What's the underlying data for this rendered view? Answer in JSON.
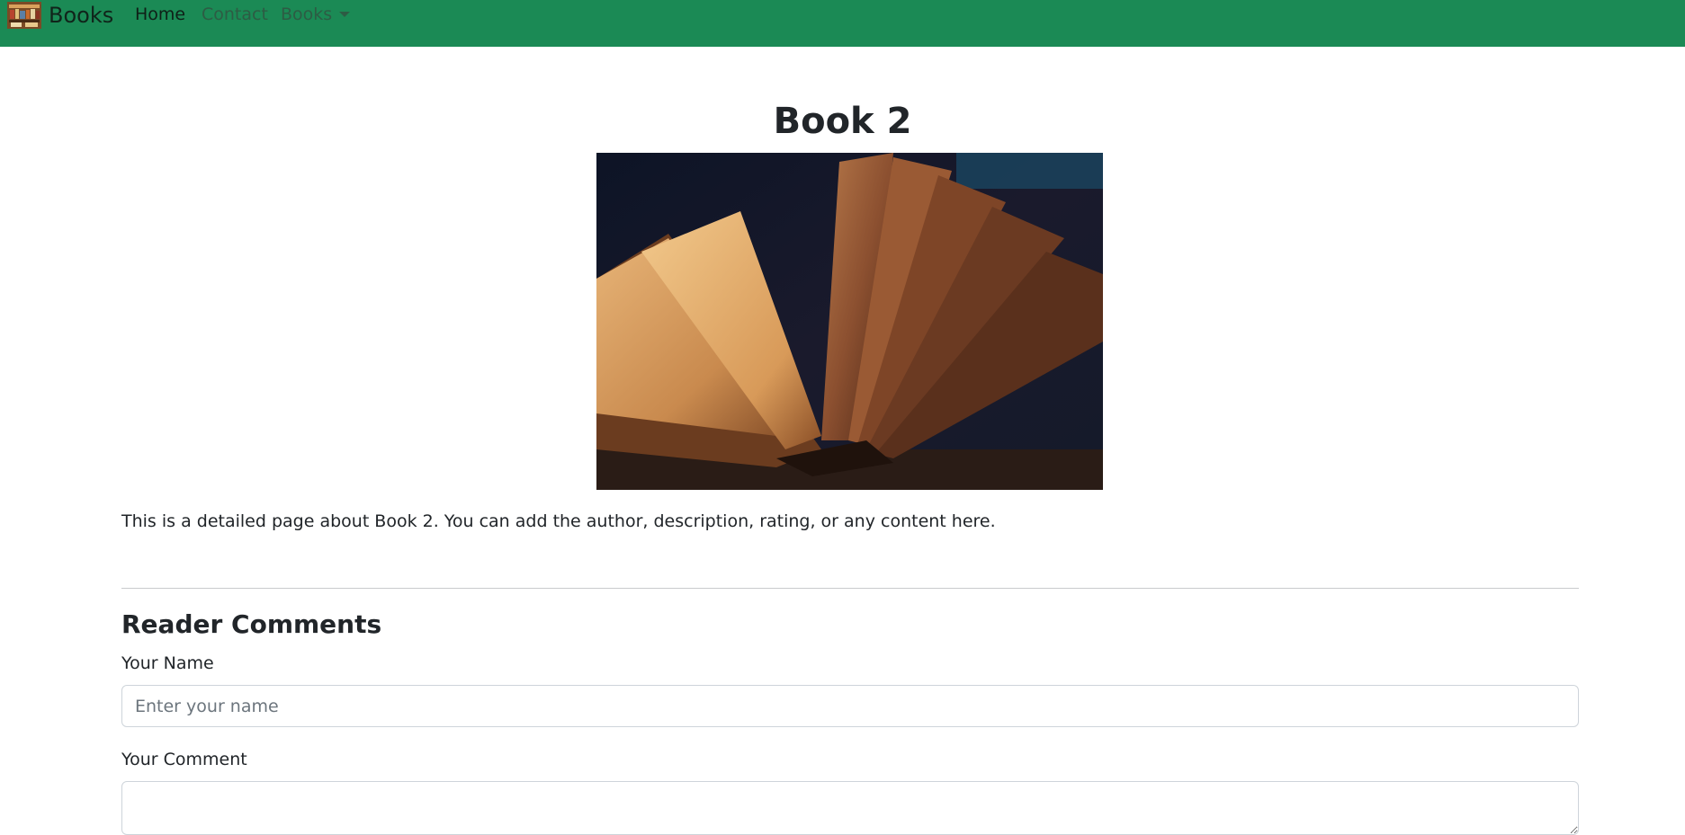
{
  "navbar": {
    "brand": "Books",
    "links": {
      "home": "Home",
      "contact": "Contact",
      "books": "Books"
    },
    "bg_color": "#1b8a55"
  },
  "main": {
    "title": "Book 2",
    "description": "This is a detailed page about Book 2. You can add the author, description, rating, or any content here."
  },
  "comments": {
    "heading": "Reader Comments",
    "name_label": "Your Name",
    "name_placeholder": "Enter your name",
    "comment_label": "Your Comment"
  }
}
